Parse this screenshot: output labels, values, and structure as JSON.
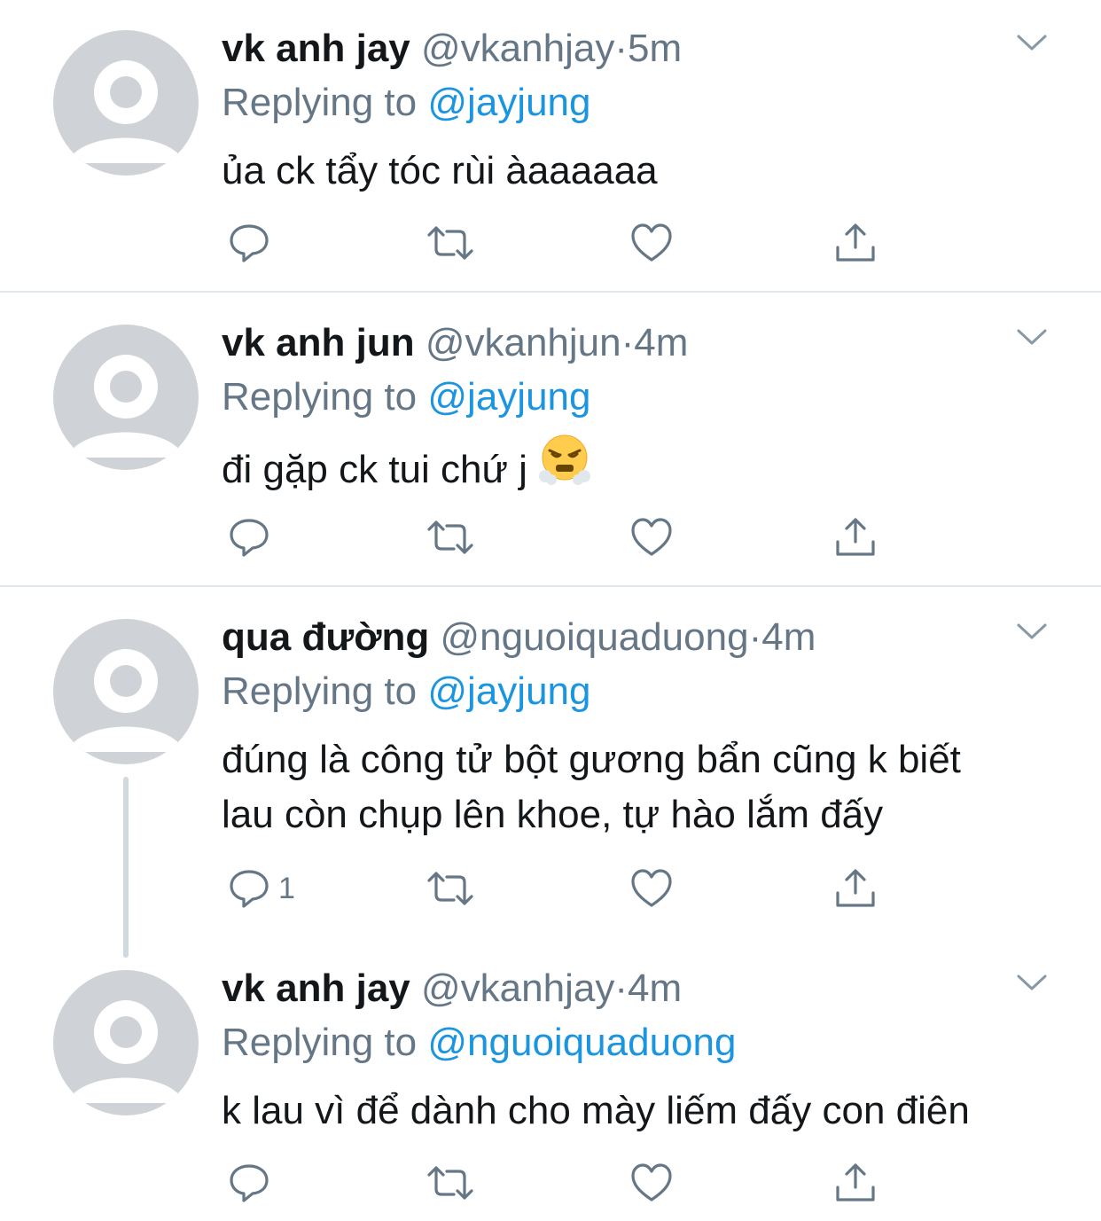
{
  "reply_prefix": "Replying to",
  "tweets": [
    {
      "name": "vk anh jay",
      "handle": "@vkanhjay",
      "dot": "·",
      "time": "5m",
      "reply_to": "@jayjung",
      "text": "ủa ck tẩy tóc rùi àaaaaaa"
    },
    {
      "name": "vk anh jun",
      "handle": "@vkanhjun",
      "dot": "·",
      "time": "4m",
      "reply_to": "@jayjung",
      "text": "đi gặp ck tui chứ j",
      "emoji": "face-with-steam-from-nose"
    },
    {
      "name": "qua đường",
      "handle": "@nguoiquaduong",
      "dot": "·",
      "time": "4m",
      "reply_to": "@jayjung",
      "text_line1": "đúng là công tử bột gương bẩn cũng k biết",
      "text_line2": "lau còn chụp lên khoe, tự hào lắm đấy",
      "reply_count": "1"
    },
    {
      "name": "vk anh jay",
      "handle": "@vkanhjay",
      "dot": "·",
      "time": "4m",
      "reply_to": "@nguoiquaduong",
      "text": "k lau vì để dành cho mày liếm đấy con điên"
    }
  ],
  "colors": {
    "name": "#14171a",
    "secondary": "#657786",
    "mention": "#1b95e0",
    "avatar": "#cfd2d6",
    "divider": "#e1e8ed",
    "thread_line": "#cfd9de"
  },
  "icons": [
    "reply-icon",
    "retweet-icon",
    "like-icon",
    "share-icon",
    "chevron-down-icon",
    "default-avatar-icon"
  ]
}
